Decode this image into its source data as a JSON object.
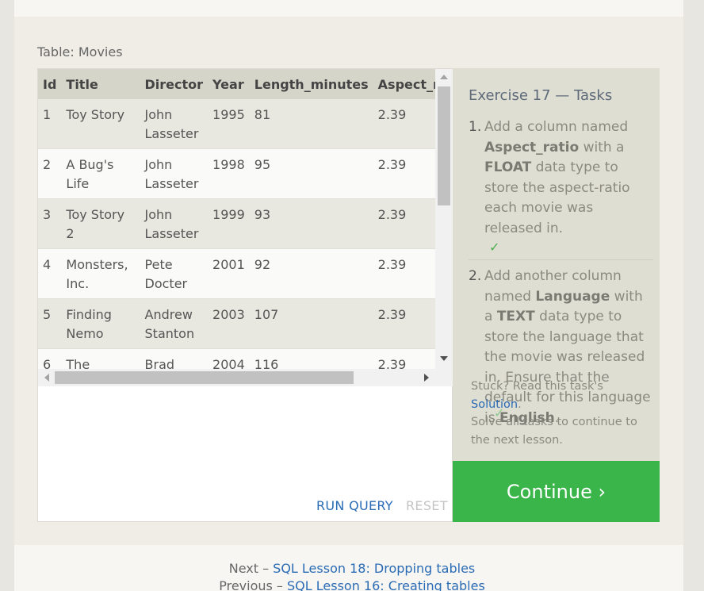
{
  "table": {
    "caption": "Table: Movies",
    "columns": [
      "Id",
      "Title",
      "Director",
      "Year",
      "Length_minutes",
      "Aspect_rati"
    ],
    "rows": [
      [
        "1",
        "Toy Story",
        "John Lasseter",
        "1995",
        "81",
        "2.39"
      ],
      [
        "2",
        "A Bug's Life",
        "John Lasseter",
        "1998",
        "95",
        "2.39"
      ],
      [
        "3",
        "Toy Story 2",
        "John Lasseter",
        "1999",
        "93",
        "2.39"
      ],
      [
        "4",
        "Monsters, Inc.",
        "Pete Docter",
        "2001",
        "92",
        "2.39"
      ],
      [
        "5",
        "Finding Nemo",
        "Andrew Stanton",
        "2003",
        "107",
        "2.39"
      ],
      [
        "6",
        "The Incredibles",
        "Brad Bird",
        "2004",
        "116",
        "2.39"
      ]
    ]
  },
  "editor": {
    "run_label": "RUN QUERY",
    "reset_label": "RESET"
  },
  "exercise": {
    "title": "Exercise 17 — Tasks",
    "task1": {
      "num": "1.",
      "pre": "Add a column named ",
      "bold1": "Aspect_ratio",
      "mid": " with a ",
      "bold2": "FLOAT",
      "post": " data type to store the aspect-ratio each movie was released in.",
      "check": "✓"
    },
    "task2": {
      "num": "2.",
      "pre": "Add another column named ",
      "bold1": "Language",
      "mid": " with a ",
      "bold2": "TEXT",
      "post": " data type to store the language that the movie was released in. Ensure that the default for this language is ",
      "bold3": "English",
      "end": ".",
      "check": "✓"
    },
    "help": {
      "stuck": "Stuck? Read this task's ",
      "solution_link": "Solution",
      "stuck_end": ".",
      "solve_all": "Solve all tasks to continue to the next lesson."
    },
    "continue_label": "Continue ›"
  },
  "footer": {
    "next_prefix": "Next – ",
    "next_link": "SQL Lesson 18: Dropping tables",
    "prev_prefix": "Previous – ",
    "prev_link": "SQL Lesson 16: Creating tables"
  },
  "colors": {
    "accent_blue": "#2a6bb5",
    "continue_green": "#3ab54a",
    "check_green": "#4caf50"
  }
}
